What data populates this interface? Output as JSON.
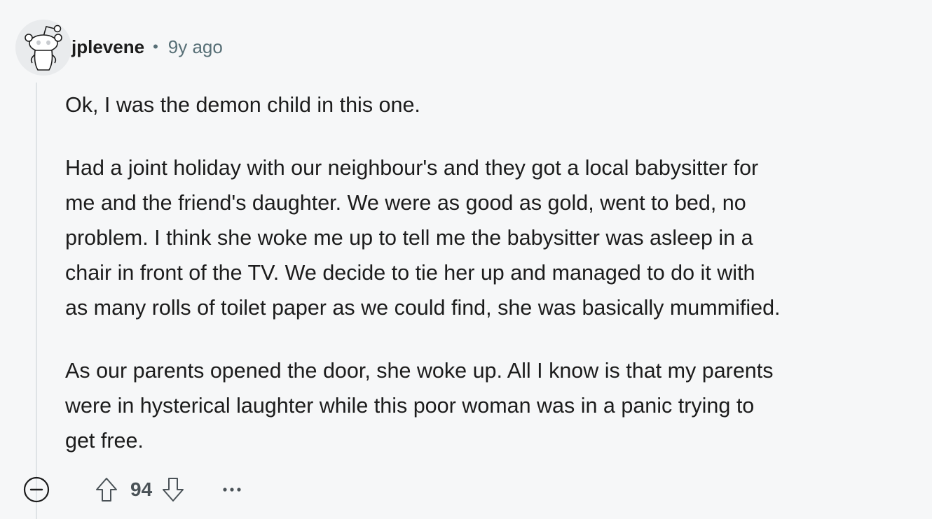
{
  "comment": {
    "author": "jplevene",
    "separator": "•",
    "age": "9y ago",
    "paragraphs": [
      [
        "Ok, I was the demon child in this one."
      ],
      [
        "Had a joint holiday with our neighbour's and they got a local babysitter for",
        "me and the friend's daughter. We were as good as gold, went to bed, no",
        "problem. I think she woke me up to tell me the babysitter was asleep in a",
        "chair in front of the TV. We decide to tie her up and managed to do it with",
        "as many rolls of toilet paper as we could find, she was basically mummified."
      ],
      [
        "As our parents opened the door, she woke up. All I know is that my parents",
        "were in hysterical laughter while this poor woman was in a panic trying to",
        "get free."
      ]
    ],
    "score": "94"
  },
  "icons": {
    "avatar": "snoo-avatar-icon",
    "collapse": "collapse-minus-icon",
    "upvote": "upvote-arrow-icon",
    "downvote": "downvote-arrow-icon",
    "more": "more-options-icon"
  },
  "colors": {
    "background": "#f6f7f8",
    "text": "#1c1c1c",
    "meta": "#576f76",
    "thread_line": "#dfe3e6"
  }
}
